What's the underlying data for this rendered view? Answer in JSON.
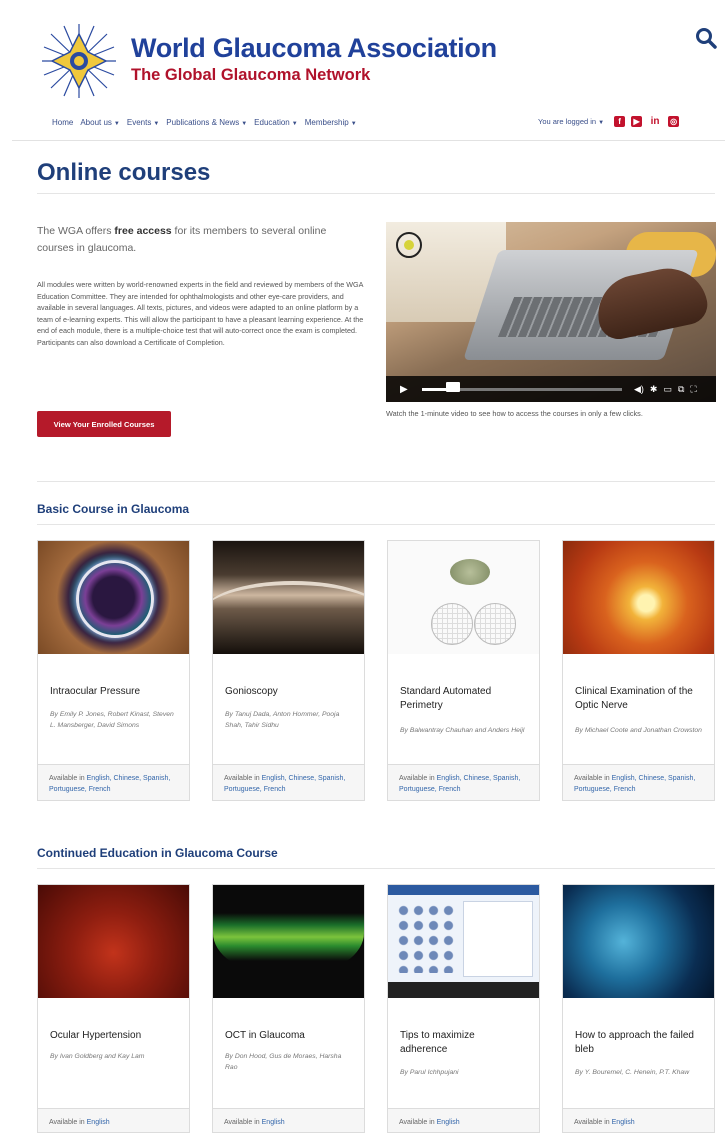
{
  "brand": {
    "title": "World Glaucoma Association",
    "subtitle": "The Global Glaucoma Network"
  },
  "nav": {
    "items": [
      {
        "label": "Home",
        "dropdown": false
      },
      {
        "label": "About us",
        "dropdown": true
      },
      {
        "label": "Events",
        "dropdown": true
      },
      {
        "label": "Publications & News",
        "dropdown": true
      },
      {
        "label": "Education",
        "dropdown": true
      },
      {
        "label": "Membership",
        "dropdown": true
      }
    ],
    "logged_in": "You are logged in",
    "social": [
      "facebook-icon",
      "youtube-icon",
      "linkedin-icon",
      "instagram-icon"
    ]
  },
  "page": {
    "title": "Online courses",
    "intro_prefix": "The WGA offers ",
    "intro_bold": "free access",
    "intro_suffix": " for its members to several online courses in glaucoma.",
    "body": "All modules were written by world-renowned experts in the field and reviewed by members of the WGA Education Committee. They are intended for ophthalmologists and other eye-care providers, and available in several languages. All texts, pictures, and videos were adapted to an online platform by a team of e-learning experts. This will allow the participant to have a pleasant learning experience. At the end of each module, there is a multiple-choice test that will auto-correct once the exam is completed. Participants can also download a Certificate of Completion.",
    "enrolled_button": "View Your Enrolled Courses",
    "video_caption": "Watch the 1-minute video to see how to access the courses in only a few clicks.",
    "video_progress": 0.12
  },
  "sections": [
    {
      "title": "Basic Course in Glaucoma",
      "courses": [
        {
          "title": "Intraocular Pressure",
          "authors": "By Emily P. Jones, Robert Kinast, Steven L. Mansberger, David Simons",
          "available": "Available in",
          "languages": "English, Chinese, Spanish, Portuguese, French"
        },
        {
          "title": "Gonioscopy",
          "authors": "By Tanuj Dada, Anton Hommer, Pooja Shah, Tahir Sidhu",
          "available": "Available in",
          "languages": "English, Chinese, Spanish, Portuguese, French"
        },
        {
          "title": "Standard Automated Perimetry",
          "authors": "By Balwantray Chauhan and Anders Heijl",
          "available": "Available in",
          "languages": "English, Chinese, Spanish, Portuguese, French"
        },
        {
          "title": "Clinical Examination of the Optic Nerve",
          "authors": "By Michael Coote and Jonathan Crowston",
          "available": "Available in",
          "languages": "English, Chinese, Spanish, Portuguese, French"
        }
      ]
    },
    {
      "title": "Continued Education in Glaucoma Course",
      "courses": [
        {
          "title": "Ocular Hypertension",
          "authors": "By Ivan Goldberg and Kay Lam",
          "available": "Available in",
          "languages": "English"
        },
        {
          "title": "OCT in Glaucoma",
          "authors": "By Don Hood, Gus de Moraes, Harsha Rao",
          "available": "Available in",
          "languages": "English"
        },
        {
          "title": "Tips to maximize adherence",
          "authors": "By Parul Ichhpujani",
          "available": "Available in",
          "languages": "English"
        },
        {
          "title": "How to approach the failed bleb",
          "authors": "By Y. Bouremel, C. Henein, P.T. Khaw",
          "available": "Available in",
          "languages": "English"
        }
      ]
    }
  ]
}
